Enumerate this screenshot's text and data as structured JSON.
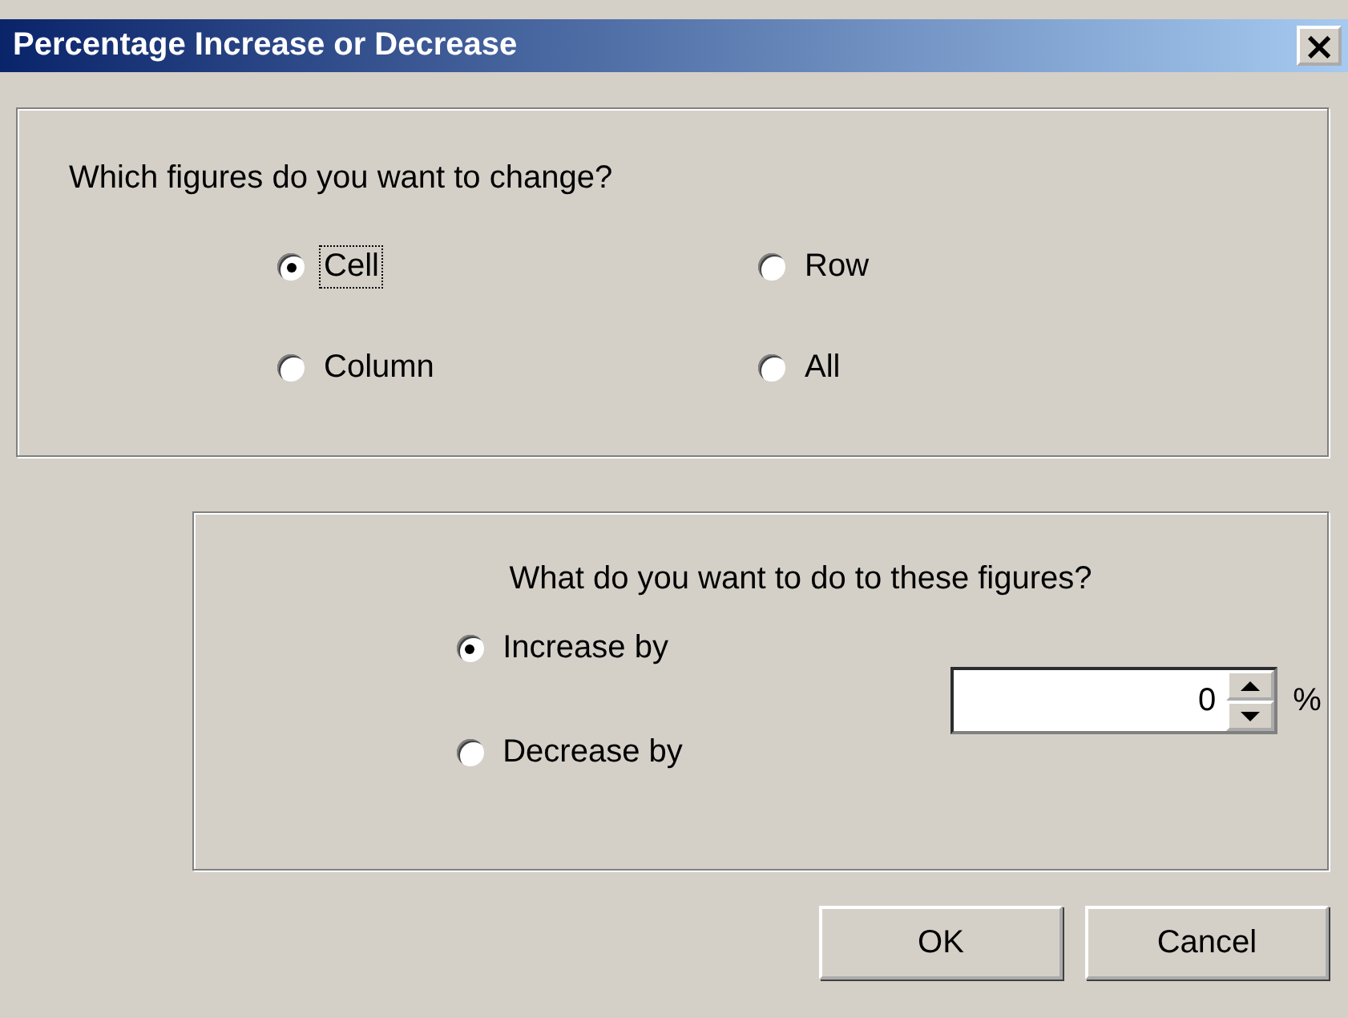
{
  "window": {
    "title": "Percentage Increase or Decrease",
    "close": "×"
  },
  "groups": [
    {
      "kind": "options",
      "question": "Which figures do you want to change?",
      "options": [
        {
          "label": "Cell",
          "selected": true,
          "focused": true
        },
        {
          "label": "Row",
          "selected": false,
          "focused": false
        },
        {
          "label": "Column",
          "selected": false,
          "focused": false
        },
        {
          "label": "All",
          "selected": false,
          "focused": false
        }
      ]
    },
    {
      "kind": "amount",
      "question": "What do you want to do to these figures?",
      "options": [
        {
          "label": "Increase by",
          "selected": true,
          "focused": false
        },
        {
          "label": "Decrease by",
          "selected": false,
          "focused": false
        }
      ],
      "spinner": {
        "value": "0",
        "unit": "%"
      }
    }
  ],
  "buttons": [
    "OK",
    "Cancel"
  ]
}
